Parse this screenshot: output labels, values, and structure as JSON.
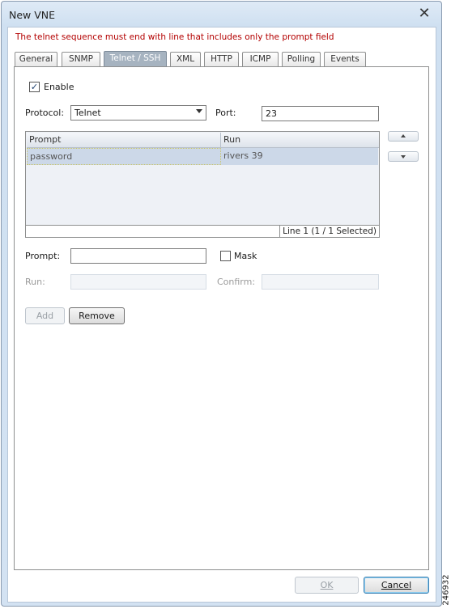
{
  "window": {
    "title": "New VNE"
  },
  "warning": "The telnet sequence must end with line that includes only the prompt field",
  "tabs": [
    {
      "label": "General",
      "active": false
    },
    {
      "label": "SNMP",
      "active": false
    },
    {
      "label": "Telnet / SSH",
      "active": true
    },
    {
      "label": "XML",
      "active": false
    },
    {
      "label": "HTTP",
      "active": false
    },
    {
      "label": "ICMP",
      "active": false
    },
    {
      "label": "Polling",
      "active": false
    },
    {
      "label": "Events",
      "active": false
    }
  ],
  "form": {
    "enable_label": "Enable",
    "enable_checked": true,
    "protocol_label": "Protocol:",
    "protocol_value": "Telnet",
    "port_label": "Port:",
    "port_value": "23"
  },
  "table": {
    "columns": [
      "Prompt",
      "Run"
    ],
    "rows": [
      {
        "prompt": "password",
        "run": "rivers 39"
      }
    ],
    "status": "Line 1 (1 / 1 Selected)"
  },
  "editor": {
    "prompt_label": "Prompt:",
    "prompt_value": "",
    "mask_label": "Mask",
    "mask_checked": false,
    "run_label": "Run:",
    "confirm_label": "Confirm:"
  },
  "buttons": {
    "add": "Add",
    "remove": "Remove",
    "ok": "OK",
    "cancel": "Cancel"
  },
  "watermark": "246932"
}
